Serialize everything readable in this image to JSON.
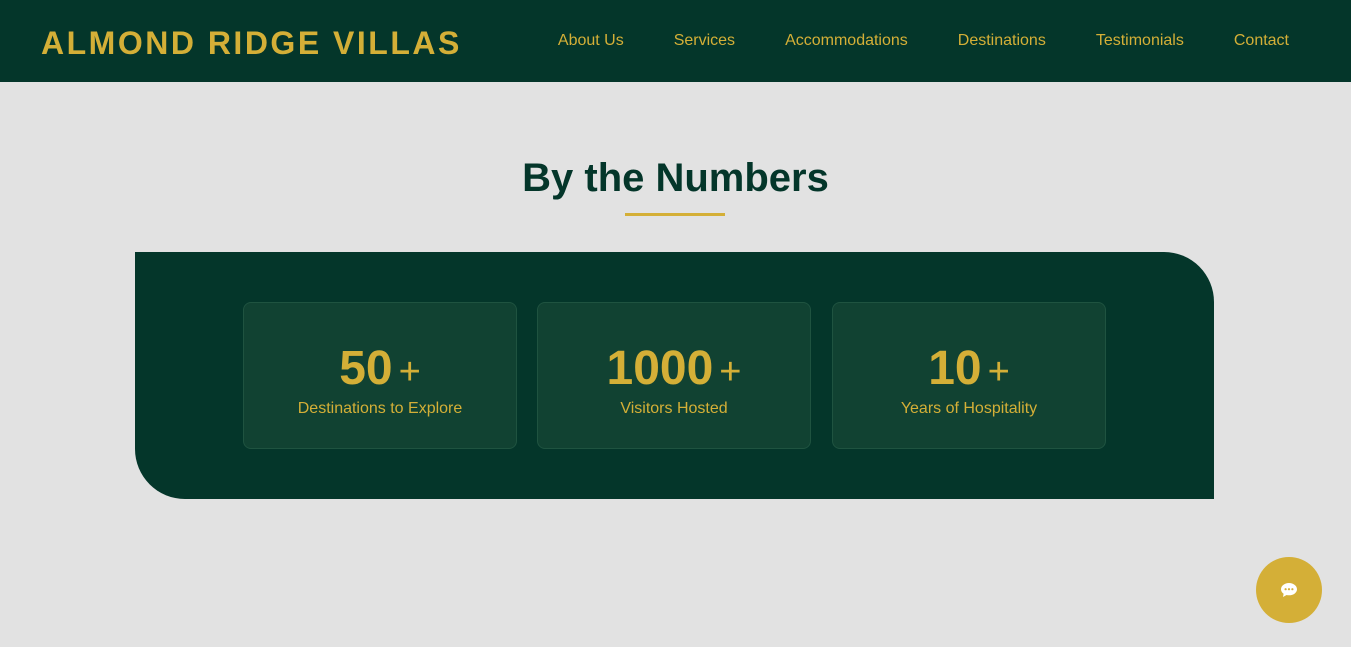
{
  "header": {
    "brand": "ALMOND RIDGE VILLAS",
    "nav": [
      "About Us",
      "Services",
      "Accommodations",
      "Destinations",
      "Testimonials",
      "Contact"
    ]
  },
  "stats_section": {
    "title": "By the Numbers",
    "stats": [
      {
        "value": "50",
        "suffix": "+",
        "label": "Destinations to Explore"
      },
      {
        "value": "1000",
        "suffix": "+",
        "label": "Visitors Hosted"
      },
      {
        "value": "10",
        "suffix": "+",
        "label": "Years of Hospitality"
      }
    ]
  },
  "chat": {
    "icon": "chat-bubble-icon"
  },
  "colors": {
    "primary": "#04362a",
    "accent": "#d4af37",
    "card": "#114232",
    "background": "#e2e2e2"
  }
}
